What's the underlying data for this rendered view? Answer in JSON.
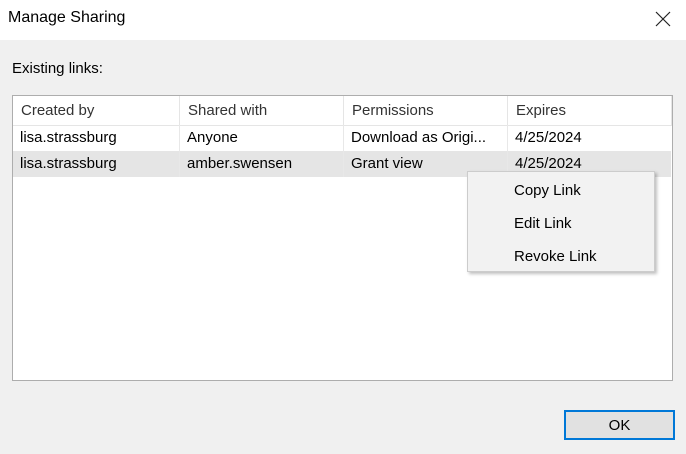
{
  "dialog": {
    "title": "Manage Sharing",
    "existing_links_label": "Existing links:",
    "ok_label": "OK"
  },
  "table": {
    "columns": [
      "Created by",
      "Shared with",
      "Permissions",
      "Expires"
    ],
    "rows": [
      {
        "created_by": "lisa.strassburg",
        "shared_with": "Anyone",
        "permissions": "Download as Origi...",
        "expires": "4/25/2024"
      },
      {
        "created_by": "lisa.strassburg",
        "shared_with": "amber.swensen",
        "permissions": "Grant view",
        "expires": "4/25/2024"
      }
    ],
    "selected_row": 1
  },
  "context_menu": {
    "items": [
      "Copy Link",
      "Edit Link",
      "Revoke Link"
    ]
  },
  "icons": {
    "close": "close-icon"
  },
  "colors": {
    "accent": "#0078d7",
    "selected_row": "#e5e5e5"
  }
}
